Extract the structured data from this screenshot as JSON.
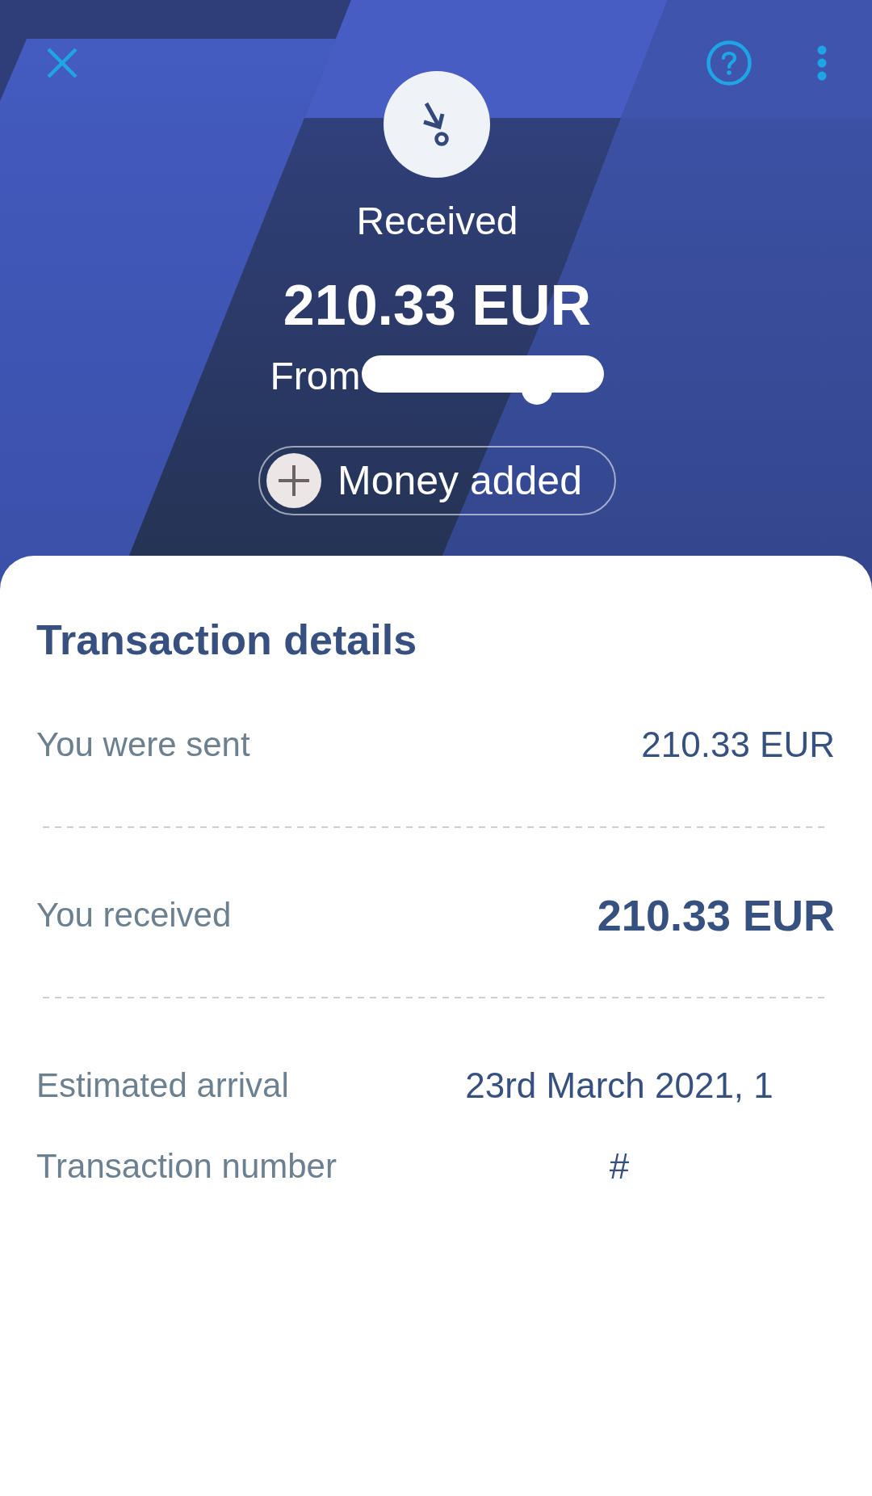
{
  "header": {
    "status": "Received",
    "amount": "210.33 EUR",
    "sender_label": "From",
    "category": "Money added"
  },
  "details": {
    "title": "Transaction details",
    "rows": [
      {
        "kind": "amount",
        "label": "You were sent",
        "value": "210.33 EUR"
      },
      {
        "kind": "total",
        "label": "You received",
        "value": "210.33 EUR"
      },
      {
        "kind": "info",
        "label": "Estimated arrival",
        "value": "23rd March 2021, 1"
      },
      {
        "kind": "info",
        "label": "Transaction number",
        "value": "#"
      }
    ]
  }
}
